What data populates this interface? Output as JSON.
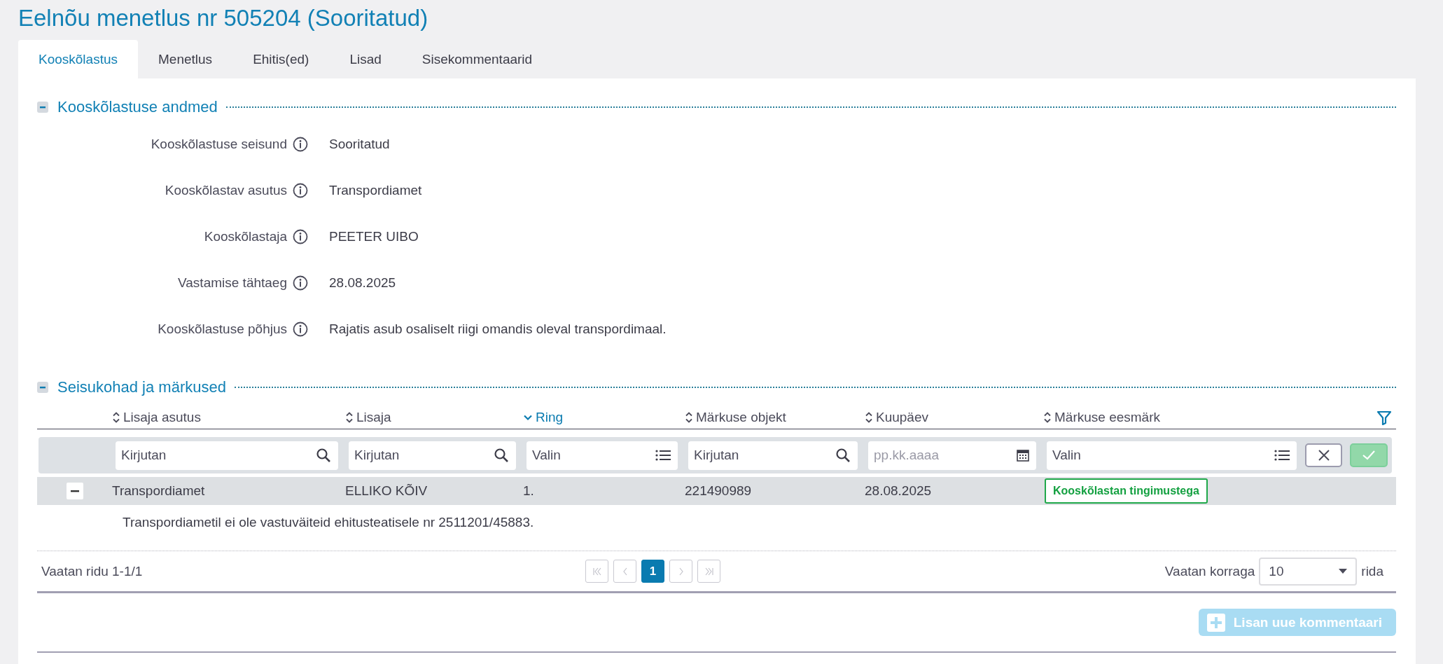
{
  "page_title": "Eelnõu menetlus nr 505204 (Sooritatud)",
  "tabs": [
    {
      "label": "Kooskõlastus",
      "selected": true
    },
    {
      "label": "Menetlus",
      "selected": false
    },
    {
      "label": "Ehitis(ed)",
      "selected": false
    },
    {
      "label": "Lisad",
      "selected": false
    },
    {
      "label": "Sisekommentaarid",
      "selected": false
    }
  ],
  "details_section": {
    "title": "Kooskõlastuse andmed",
    "expanded": true,
    "fields": [
      {
        "label": "Kooskõlastuse seisund",
        "value": "Sooritatud"
      },
      {
        "label": "Kooskõlastav asutus",
        "value": "Transpordiamet"
      },
      {
        "label": "Kooskõlastaja",
        "value": "PEETER UIBO"
      },
      {
        "label": "Vastamise tähtaeg",
        "value": "28.08.2025"
      },
      {
        "label": "Kooskõlastuse põhjus",
        "value": "Rajatis asub osaliselt riigi omandis oleval transpordimaal."
      }
    ]
  },
  "remarks_section": {
    "title": "Seisukohad ja märkused",
    "expanded": true,
    "table": {
      "columns": [
        {
          "label": "Lisaja asutus",
          "sorted": false
        },
        {
          "label": "Lisaja",
          "sorted": false
        },
        {
          "label": "Ring",
          "sorted": true
        },
        {
          "label": "Märkuse objekt",
          "sorted": false
        },
        {
          "label": "Kuupäev",
          "sorted": false
        },
        {
          "label": "Märkuse eesmärk",
          "sorted": false
        }
      ],
      "filters": [
        {
          "kind": "text",
          "placeholder": "Kirjutan"
        },
        {
          "kind": "text",
          "placeholder": "Kirjutan"
        },
        {
          "kind": "select",
          "placeholder": "Valin"
        },
        {
          "kind": "text",
          "placeholder": "Kirjutan"
        },
        {
          "kind": "date",
          "placeholder": "pp.kk.aaaa"
        },
        {
          "kind": "select",
          "placeholder": "Valin"
        }
      ],
      "rows": [
        {
          "expanded": true,
          "cells": [
            "Transpordiamet",
            "ELLIKO KÕIV",
            "1.",
            "221490989",
            "28.08.2025"
          ],
          "purpose": "Kooskõlastan tingimustega",
          "comment": "Transpordiametil ei ole vastuväiteid ehitusteatisele nr 2511201/45883."
        }
      ]
    },
    "pagination": {
      "summary": "Vaatan ridu 1-1/1",
      "pages": [
        {
          "kind": "first",
          "disabled": true
        },
        {
          "kind": "prev",
          "disabled": true
        },
        {
          "kind": "page",
          "label": "1",
          "selected": true
        },
        {
          "kind": "next",
          "disabled": true
        },
        {
          "kind": "last",
          "disabled": true
        }
      ],
      "page_size_label": "Vaatan korraga",
      "page_size": "10",
      "page_size_suffix": "rida"
    },
    "add_button": {
      "label": "Lisan uue kommentaari",
      "disabled": true
    }
  }
}
